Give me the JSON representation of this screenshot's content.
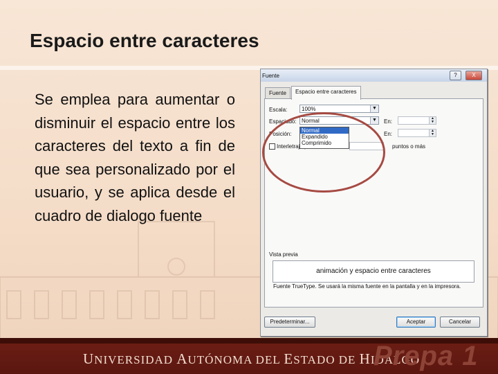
{
  "slide": {
    "title": "Espacio entre caracteres",
    "body": "Se emplea para aumentar o disminuir el espacio entre los caracteres del texto a fin de que sea personalizado por el usuario, y se aplica desde el cuadro de dialogo fuente",
    "footer_parts": [
      "U",
      "NIVERSIDAD ",
      "A",
      "UTÓNOMA DEL ",
      "E",
      "STADO DE ",
      "H",
      "IDALGO"
    ],
    "logo": "Prepa 1"
  },
  "dialog": {
    "title": "Fuente",
    "help_label": "?",
    "close_label": "X",
    "tabs": [
      {
        "label": "Fuente",
        "active": false
      },
      {
        "label": "Espacio entre caracteres",
        "active": true
      }
    ],
    "escala_label": "Escala:",
    "escala_value": "100%",
    "espaciado_label": "Espaciado:",
    "espaciado_value": "Normal",
    "posicion_label": "Posición:",
    "en_label_1": "En:",
    "en_label_2": "En:",
    "espaciado_options": [
      "Normal",
      "Expandido",
      "Comprimido"
    ],
    "kerning_label": "Interletraje para fuentes:",
    "kerning_suffix": "puntos o más",
    "preview_label": "Vista previa",
    "preview_text": "animación y espacio entre caracteres",
    "truetype_note": "Fuente TrueType. Se usará la misma fuente en la pantalla y en la impresora.",
    "buttons": {
      "default": "Predeterminar...",
      "accept": "Aceptar",
      "cancel": "Cancelar"
    }
  },
  "colors": {
    "footer_bg": "#6e1e14",
    "highlight_circle": "#a64a42",
    "selection": "#316ac5"
  }
}
